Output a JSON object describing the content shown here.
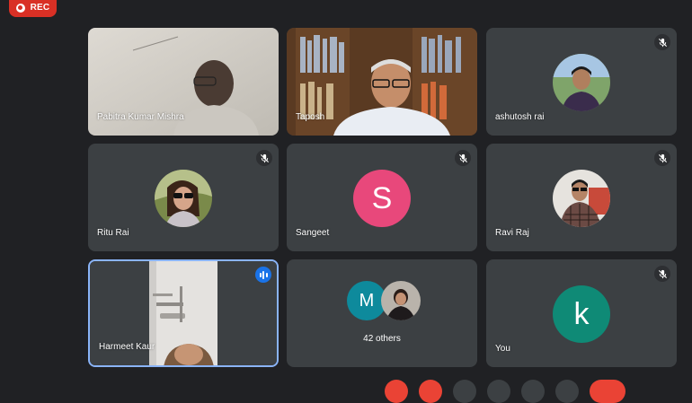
{
  "recording": {
    "label": "REC"
  },
  "participants": [
    {
      "name": "Pabitra Kumar Mishra",
      "type": "video"
    },
    {
      "name": "Taposh",
      "type": "video"
    },
    {
      "name": "ashutosh rai",
      "type": "photo",
      "muted": true
    },
    {
      "name": "Ritu Rai",
      "type": "photo",
      "muted": true
    },
    {
      "name": "Sangeet",
      "type": "letter",
      "initial": "S",
      "color": "#e8487b",
      "muted": true
    },
    {
      "name": "Ravi Raj",
      "type": "photo",
      "muted": true
    },
    {
      "name": "Harmeet Kaur",
      "type": "video",
      "speaking": true
    },
    {
      "name": "You",
      "type": "letter",
      "initial": "k",
      "color": "#0f8a76",
      "muted": true
    }
  ],
  "others": {
    "label": "42 others",
    "initial": "M",
    "color": "#0e8a9c"
  },
  "colors": {
    "background": "#202124",
    "tile": "#3c4043",
    "record": "#d93025",
    "speaking": "#1a73e8"
  }
}
